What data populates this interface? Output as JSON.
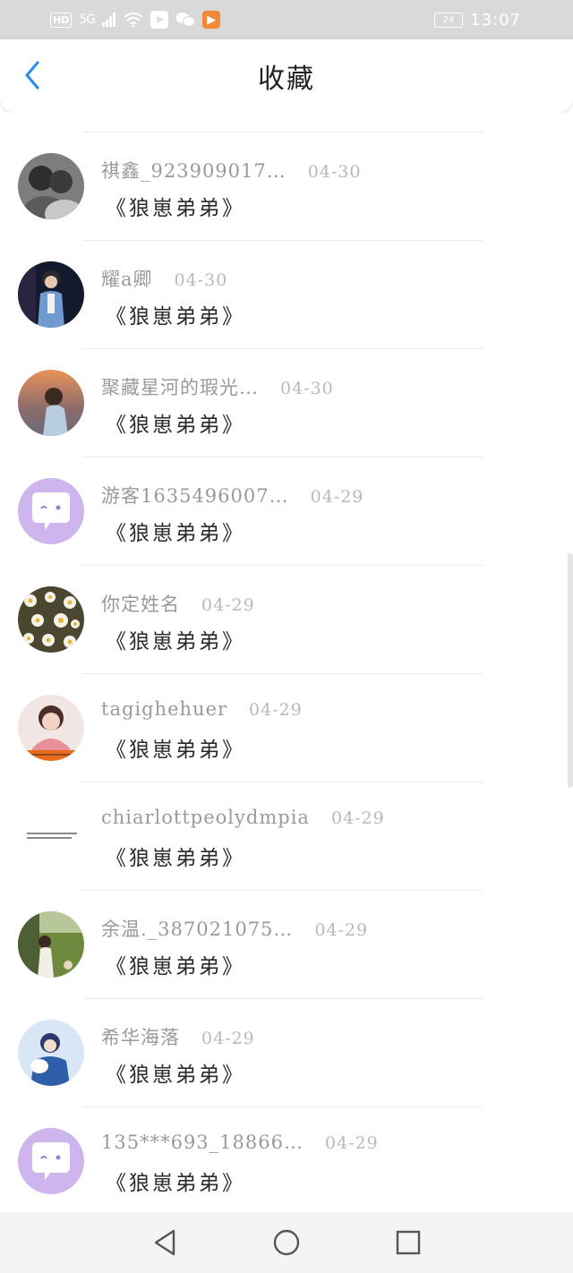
{
  "status_bar": {
    "hd": "HD",
    "network": "5G",
    "signal_icon": "signal-bars-icon",
    "wifi_icon": "wifi-icon",
    "apps": [
      "app-icon",
      "wechat-icon",
      "video-app-icon"
    ],
    "battery": "24",
    "time": "13:07"
  },
  "header": {
    "title": "收藏",
    "back_icon": "chevron-left-icon",
    "accent_color": "#2b8fe8"
  },
  "favorites": [
    {
      "name": "祺鑫_923909017…",
      "date": "04-30",
      "title": "《狼崽弟弟》",
      "avatar": "photo"
    },
    {
      "name": "耀a卿",
      "date": "04-30",
      "title": "《狼崽弟弟》",
      "avatar": "photo"
    },
    {
      "name": "聚藏星河的瑕光…",
      "date": "04-30",
      "title": "《狼崽弟弟》",
      "avatar": "photo"
    },
    {
      "name": "游客1635496007…",
      "date": "04-29",
      "title": "《狼崽弟弟》",
      "avatar": "default-chat-bubble"
    },
    {
      "name": "你定姓名",
      "date": "04-29",
      "title": "《狼崽弟弟》",
      "avatar": "photo"
    },
    {
      "name": "tagighehuer",
      "date": "04-29",
      "title": "《狼崽弟弟》",
      "avatar": "photo"
    },
    {
      "name": "chiarlottpeolydmpia",
      "date": "04-29",
      "title": "《狼崽弟弟》",
      "avatar": "text-image"
    },
    {
      "name": "余温._387021075…",
      "date": "04-29",
      "title": "《狼崽弟弟》",
      "avatar": "photo"
    },
    {
      "name": "希华海落",
      "date": "04-29",
      "title": "《狼崽弟弟》",
      "avatar": "photo"
    },
    {
      "name": "135***693_18866…",
      "date": "04-29",
      "title": "《狼崽弟弟》",
      "avatar": "default-chat-bubble"
    }
  ],
  "bottom_nav": {
    "back": "triangle-back-icon",
    "home": "circle-home-icon",
    "recents": "square-recents-icon"
  }
}
